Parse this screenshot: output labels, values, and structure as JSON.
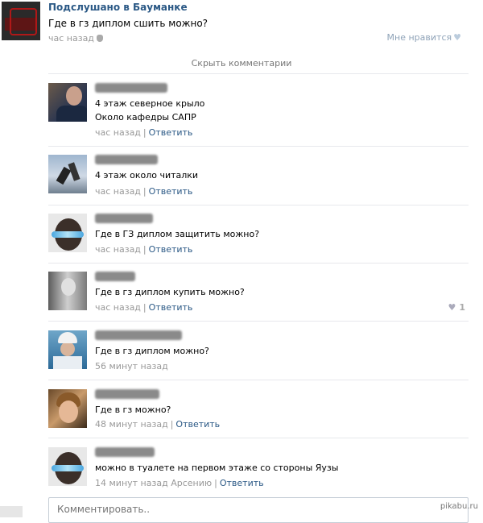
{
  "post": {
    "author": "Подслушано в Бауманке",
    "text": "Где в гз диплом сшить можно?",
    "time": "час назад",
    "like_label": "Мне нравится"
  },
  "hide_comments": "Скрыть комментарии",
  "comments": [
    {
      "lines": [
        "4 этаж северное крыло",
        "Около кафедры САПР"
      ],
      "time": "час назад",
      "reply": "Ответить"
    },
    {
      "lines": [
        "4 этаж около читалки"
      ],
      "time": "час назад",
      "reply": "Ответить"
    },
    {
      "lines": [
        "Где в ГЗ диплом защитить можно?"
      ],
      "time": "час назад",
      "reply": "Ответить"
    },
    {
      "lines": [
        "Где в гз диплом купить можно?"
      ],
      "time": "час назад",
      "reply": "Ответить",
      "likes": "1"
    },
    {
      "lines": [
        "Где в гз диплом можно?"
      ],
      "time": "56 минут назад"
    },
    {
      "lines": [
        "Где в гз можно?"
      ],
      "time": "48 минут назад",
      "reply": "Ответить"
    },
    {
      "lines": [
        "можно в туалете на первом этаже со стороны Яузы"
      ],
      "time": "14 минут назад",
      "reply_to": "Арсению",
      "reply": "Ответить"
    }
  ],
  "comment_input": {
    "placeholder": "Комментировать.."
  },
  "watermark": "pikabu.ru"
}
